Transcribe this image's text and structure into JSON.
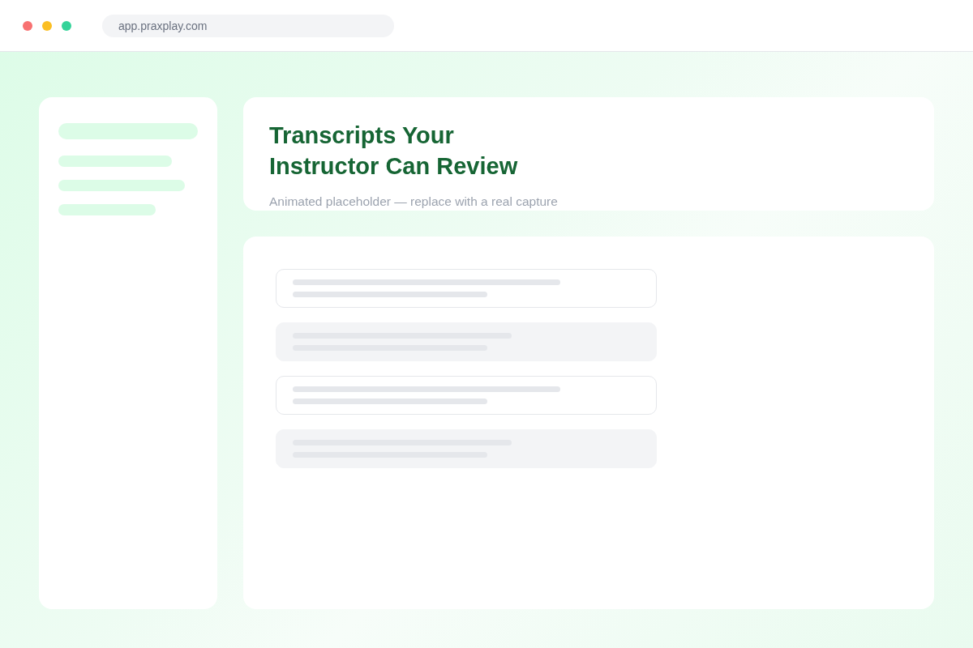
{
  "browser": {
    "url": "app.praxplay.com"
  },
  "header": {
    "title_lines": [
      "Transcripts Your",
      "Instructor Can Review"
    ],
    "subtitle": "Animated placeholder — replace with a real capture"
  },
  "rows": [
    {
      "kind": "outlined"
    },
    {
      "kind": "filled"
    },
    {
      "kind": "outlined"
    },
    {
      "kind": "filled"
    }
  ]
}
